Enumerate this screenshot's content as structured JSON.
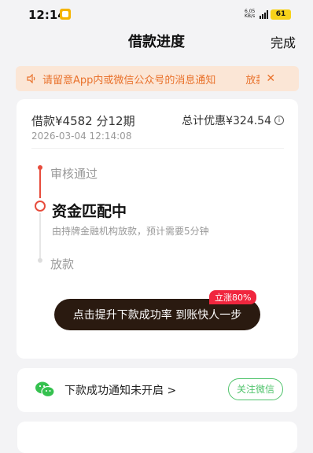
{
  "status_bar": {
    "time": "12:14",
    "net_speed": "6.05 KB/s",
    "signal_label": "5G",
    "battery": "61"
  },
  "nav": {
    "title": "借款进度",
    "done_label": "完成"
  },
  "notice": {
    "text": "请留意App内或微信公众号的消息通知",
    "text_continued": "放款"
  },
  "loan": {
    "summary": "借款¥4582  分12期",
    "discount": "总计优惠¥324.54",
    "timestamp": "2026-03-04 12:14:08"
  },
  "timeline": {
    "steps": [
      {
        "label": "审核通过"
      },
      {
        "label": "资金匹配中",
        "desc": "由持牌金融机构放款，预计需要5分钟"
      },
      {
        "label": "放款"
      }
    ]
  },
  "boost": {
    "label": "点击提升下款成功率 到账快人一步",
    "badge": "立涨80%"
  },
  "notification": {
    "text": "下款成功通知未开启 >",
    "follow_label": "关注微信"
  }
}
